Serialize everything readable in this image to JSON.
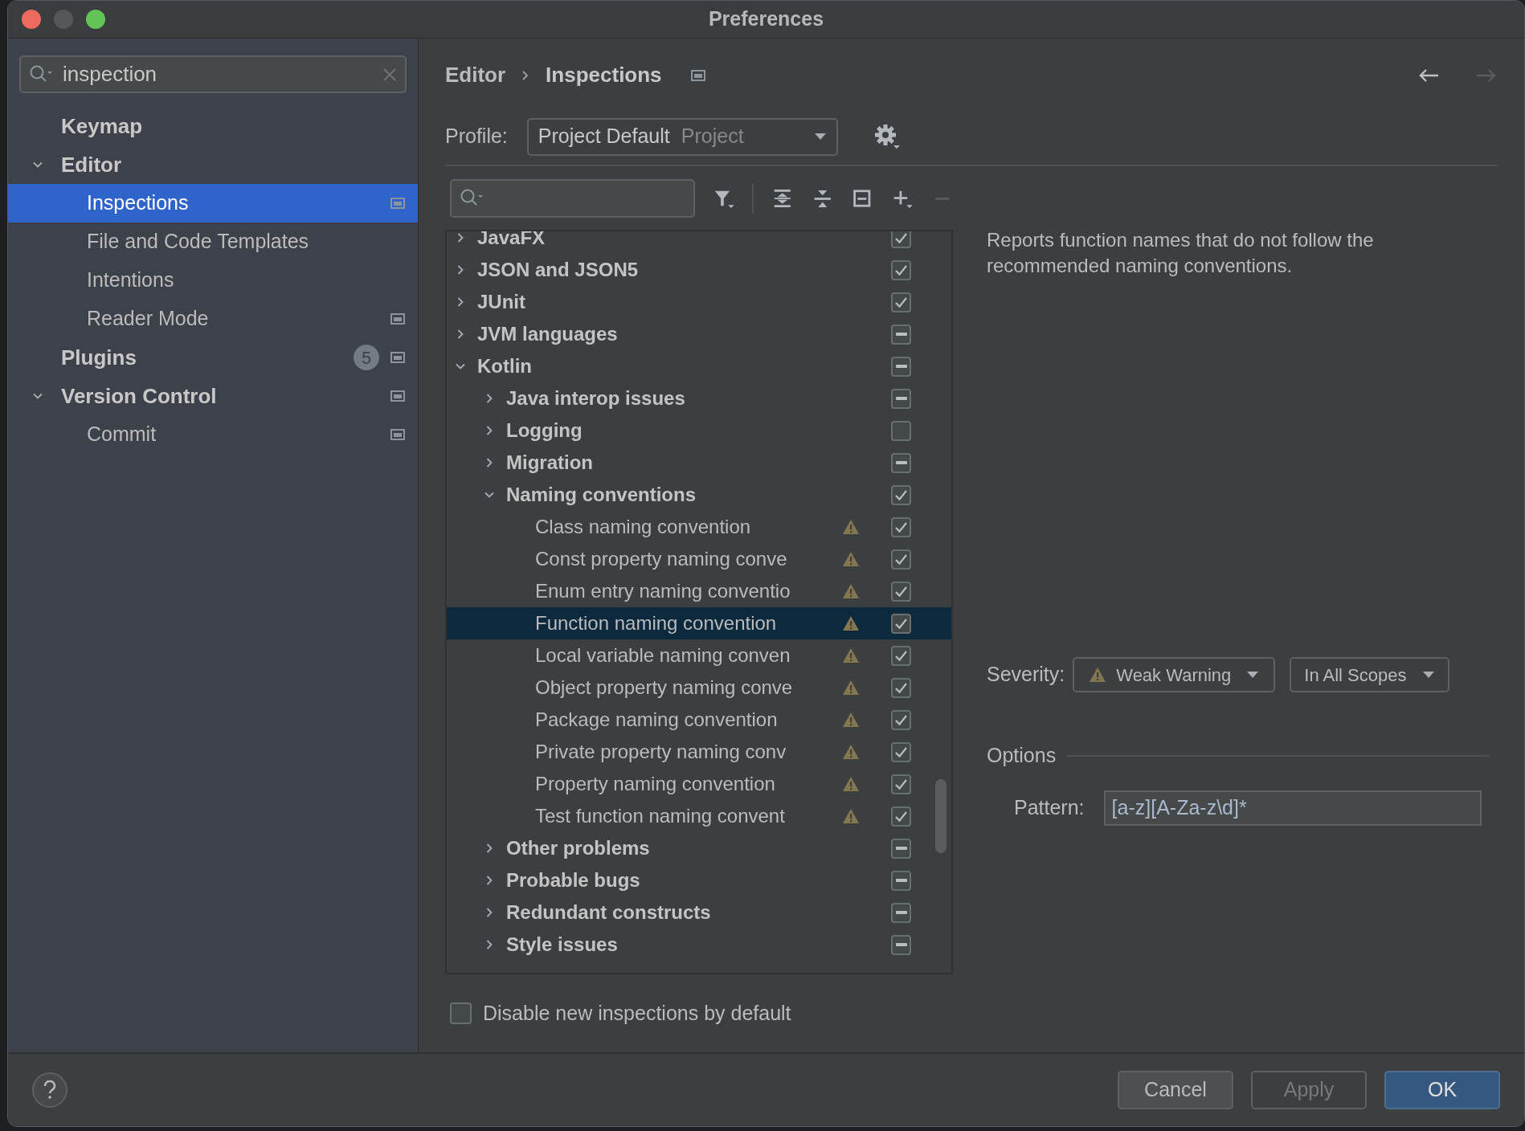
{
  "window": {
    "title": "Preferences"
  },
  "sidebar": {
    "search": {
      "value": "inspection"
    },
    "items": [
      {
        "label": "Keymap",
        "selected": false,
        "project": false
      },
      {
        "label": "Editor",
        "selected": false,
        "expanded": true,
        "project": false,
        "children": [
          {
            "label": "Inspections",
            "selected": true,
            "project": true
          },
          {
            "label": "File and Code Templates",
            "selected": false,
            "project": false
          },
          {
            "label": "Intentions",
            "selected": false,
            "project": false
          },
          {
            "label": "Reader Mode",
            "selected": false,
            "project": true
          }
        ]
      },
      {
        "label": "Plugins",
        "selected": false,
        "project": true,
        "badge": "5"
      },
      {
        "label": "Version Control",
        "selected": false,
        "expanded": true,
        "project": true,
        "children": [
          {
            "label": "Commit",
            "selected": false,
            "project": true
          }
        ]
      }
    ]
  },
  "breadcrumb": [
    "Editor",
    "Inspections"
  ],
  "navigation": {
    "back_disabled": false,
    "forward_disabled": true
  },
  "profile": {
    "label": "Profile:",
    "value": "Project Default",
    "scope": "Project"
  },
  "toolbar": [
    {
      "kind": "filter",
      "disabled": false
    },
    {
      "kind": "expand",
      "disabled": false
    },
    {
      "kind": "collapse",
      "disabled": false
    },
    {
      "kind": "reset",
      "disabled": false
    },
    {
      "kind": "add",
      "disabled": false
    },
    {
      "kind": "remove",
      "disabled": true
    }
  ],
  "tree": [
    {
      "label": "JavaFX",
      "expanded": false,
      "checked": true,
      "partial": false
    },
    {
      "label": "JSON and JSON5",
      "expanded": false,
      "checked": true,
      "partial": false
    },
    {
      "label": "JUnit",
      "expanded": false,
      "checked": true,
      "partial": false
    },
    {
      "label": "JVM languages",
      "expanded": false,
      "checked": true,
      "partial": true
    },
    {
      "label": "Kotlin",
      "expanded": true,
      "checked": true,
      "partial": true,
      "children": [
        {
          "label": "Java interop issues",
          "expanded": false,
          "checked": true,
          "partial": true
        },
        {
          "label": "Logging",
          "expanded": false,
          "checked": false,
          "partial": false
        },
        {
          "label": "Migration",
          "expanded": false,
          "checked": true,
          "partial": true
        },
        {
          "label": "Naming conventions",
          "expanded": true,
          "checked": true,
          "partial": false,
          "children": [
            {
              "label": "Class naming convention",
              "checked": true,
              "warning": true,
              "selected": false
            },
            {
              "label": "Const property naming conve",
              "checked": true,
              "warning": true,
              "selected": false
            },
            {
              "label": "Enum entry naming conventio",
              "checked": true,
              "warning": true,
              "selected": false
            },
            {
              "label": "Function naming convention",
              "checked": true,
              "warning": true,
              "selected": true
            },
            {
              "label": "Local variable naming conven",
              "checked": true,
              "warning": true,
              "selected": false
            },
            {
              "label": "Object property naming conve",
              "checked": true,
              "warning": true,
              "selected": false
            },
            {
              "label": "Package naming convention",
              "checked": true,
              "warning": true,
              "selected": false
            },
            {
              "label": "Private property naming conv",
              "checked": true,
              "warning": true,
              "selected": false
            },
            {
              "label": "Property naming convention",
              "checked": true,
              "warning": true,
              "selected": false
            },
            {
              "label": "Test function naming convent",
              "checked": true,
              "warning": true,
              "selected": false
            }
          ]
        },
        {
          "label": "Other problems",
          "expanded": false,
          "checked": true,
          "partial": true
        },
        {
          "label": "Probable bugs",
          "expanded": false,
          "checked": true,
          "partial": true
        },
        {
          "label": "Redundant constructs",
          "expanded": false,
          "checked": true,
          "partial": true
        },
        {
          "label": "Style issues",
          "expanded": false,
          "checked": true,
          "partial": true
        }
      ]
    }
  ],
  "description": "Reports function names that do not follow the recommended naming conventions.",
  "severity": {
    "label": "Severity:",
    "value": "Weak Warning",
    "scope": "In All Scopes"
  },
  "options": {
    "title": "Options",
    "pattern_label": "Pattern:",
    "pattern": "[a-z][A-Za-z\\d]*"
  },
  "disable_new": {
    "label": "Disable new inspections by default",
    "checked": false
  },
  "buttons": [
    {
      "label": "Cancel",
      "kind": "normal",
      "disabled": false
    },
    {
      "label": "Apply",
      "kind": "normal",
      "disabled": true
    },
    {
      "label": "OK",
      "kind": "default",
      "disabled": false
    }
  ]
}
